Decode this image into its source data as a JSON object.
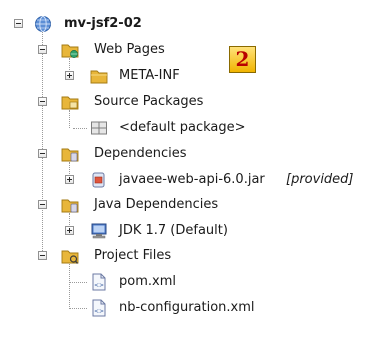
{
  "project": {
    "name": "mv-jsf2-02"
  },
  "nodes": {
    "web_pages": {
      "label": "Web Pages"
    },
    "meta_inf": {
      "label": "META-INF"
    },
    "source_packages": {
      "label": "Source Packages"
    },
    "default_package": {
      "label": "<default package>"
    },
    "dependencies": {
      "label": "Dependencies"
    },
    "javaee_jar": {
      "label": "javaee-web-api-6.0.jar",
      "scope": "[provided]"
    },
    "java_dependencies": {
      "label": "Java Dependencies"
    },
    "jdk": {
      "label": "JDK 1.7 (Default)"
    },
    "project_files": {
      "label": "Project Files"
    },
    "pom": {
      "label": "pom.xml"
    },
    "nb_config": {
      "label": "nb-configuration.xml"
    }
  },
  "badge": {
    "text": "2"
  },
  "icons": {
    "project": "globe-icon",
    "folder": "folder-icon",
    "package": "package-icon",
    "jar": "jar-icon",
    "jdk": "computer-icon",
    "xml": "xml-file-icon"
  },
  "colors": {
    "folder": "#e8b63a",
    "badge": "#f1b400",
    "badge_text": "#b80000"
  }
}
